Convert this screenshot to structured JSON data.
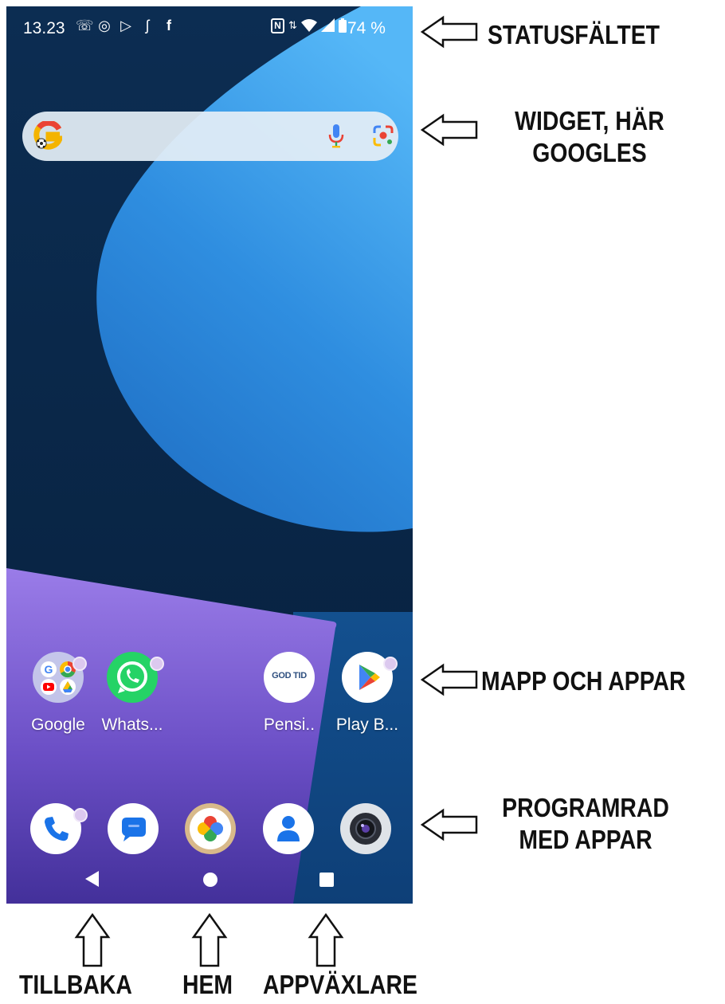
{
  "status_bar": {
    "time": "13.23",
    "left_icons": [
      "missed-call-icon",
      "whatsapp-icon",
      "play-store-icon",
      "swish-icon",
      "facebook-icon"
    ],
    "right_icons": [
      "nfc-icon",
      "data-arrows-icon",
      "wifi-icon",
      "signal-icon",
      "battery-icon"
    ],
    "battery": "74 %"
  },
  "search_widget": {
    "icons": [
      "google-g-icon",
      "microphone-icon",
      "google-lens-icon"
    ]
  },
  "folder_row": [
    {
      "label": "Google",
      "icon": "google-folder-icon",
      "badge": true
    },
    {
      "label": "Whats...",
      "icon": "whatsapp-icon",
      "badge": true
    },
    {
      "label": "Pensi..",
      "icon": "godtid-icon",
      "icon_text": "GOD TID",
      "badge": false
    },
    {
      "label": "Play B...",
      "icon": "play-store-icon",
      "badge": true
    }
  ],
  "dock": [
    {
      "icon": "phone-icon",
      "badge": true
    },
    {
      "icon": "messages-icon",
      "badge": false
    },
    {
      "icon": "photos-icon",
      "badge": false
    },
    {
      "icon": "contacts-icon",
      "badge": false
    },
    {
      "icon": "camera-icon",
      "badge": false
    }
  ],
  "nav_bar": {
    "icons": [
      "back-icon",
      "home-icon",
      "recents-icon"
    ]
  },
  "annotations": {
    "status_bar": "STATUSFÄLTET",
    "widget_line1": "WIDGET, HÄR",
    "widget_line2": "GOOGLES",
    "apps": "MAPP OCH APPAR",
    "dock_line1": "PROGRAMRAD",
    "dock_line2": "MED APPAR",
    "back": "TILLBAKA",
    "home": "HEM",
    "recents": "APPVÄXLARE"
  },
  "colors": {
    "wallpaper_dark": "#0b2947",
    "wallpaper_blue": "#2f8ee0",
    "wallpaper_purple": "#8a6fe0",
    "accent_whatsapp": "#25d366"
  }
}
